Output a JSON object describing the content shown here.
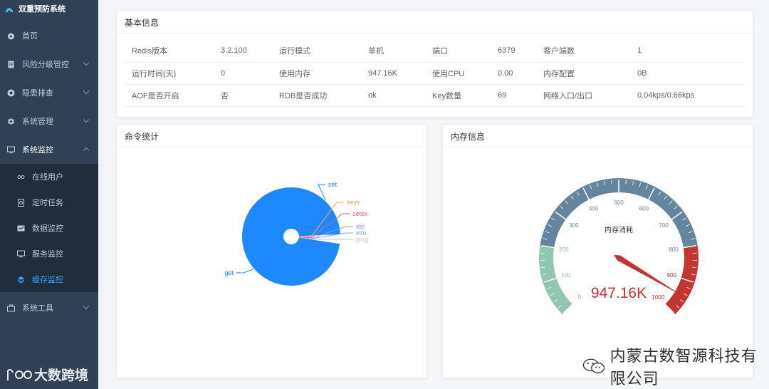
{
  "app": {
    "title": "双重预防系统"
  },
  "sidebar": {
    "items": [
      {
        "label": "首页",
        "icon": "dashboard-icon"
      },
      {
        "label": "风险分级管控",
        "icon": "document-icon"
      },
      {
        "label": "隐患排查",
        "icon": "gear-icon"
      },
      {
        "label": "系统管理",
        "icon": "settings-icon"
      },
      {
        "label": "系统监控",
        "icon": "monitor-icon"
      },
      {
        "label": "系统工具",
        "icon": "toolbox-icon"
      }
    ],
    "submenu": [
      {
        "label": "在线用户",
        "icon": "online-user-icon"
      },
      {
        "label": "定时任务",
        "icon": "job-icon"
      },
      {
        "label": "数据监控",
        "icon": "data-monitor-icon"
      },
      {
        "label": "服务监控",
        "icon": "server-icon"
      },
      {
        "label": "缓存监控",
        "icon": "cache-icon"
      }
    ]
  },
  "basic_info": {
    "title": "基本信息",
    "rows": [
      [
        "Redis版本",
        "3.2.100",
        "运行模式",
        "单机",
        "端口",
        "6379",
        "客户端数",
        "1"
      ],
      [
        "运行时间(天)",
        "0",
        "使用内存",
        "947.16K",
        "使用CPU",
        "0.00",
        "内存配置",
        "0B"
      ],
      [
        "AOF是否开启",
        "否",
        "RDB是否成功",
        "ok",
        "Key数量",
        "69",
        "网络入口/出口",
        "0.04kps/0.66kps"
      ]
    ]
  },
  "command_stats": {
    "title": "命令统计",
    "legend": [
      "set",
      "keys",
      "setex",
      "del",
      "info",
      "ping",
      "get"
    ]
  },
  "memory_info": {
    "title": "内存信息",
    "gauge_title": "内存消耗",
    "value_label": "947.16K"
  },
  "chart_data": [
    {
      "type": "pie",
      "labels": [
        "get",
        "set",
        "keys",
        "setex",
        "del",
        "info",
        "ping"
      ],
      "values": [
        75,
        25,
        1.5,
        0.6,
        0.5,
        0.35,
        0.3
      ],
      "colors": [
        "#1e88ff",
        "#1e88ff",
        "#f4a460",
        "#e05c8a",
        "#a890ff",
        "#7fa3ff",
        "#c0c4cc"
      ]
    },
    {
      "type": "gauge",
      "min": 0,
      "max": 1000,
      "value": 947.16,
      "ticks": [
        "0",
        "100",
        "200",
        "300",
        "400",
        "500",
        "600",
        "700",
        "800",
        "900",
        "1000"
      ],
      "bands": [
        {
          "to": 0.2,
          "color": "#91c7ae"
        },
        {
          "to": 0.8,
          "color": "#63869e"
        },
        {
          "to": 1.0,
          "color": "#c23531"
        }
      ]
    }
  ],
  "watermarks": {
    "left": "大数跨境",
    "right": "内蒙古数智源科技有限公司"
  }
}
